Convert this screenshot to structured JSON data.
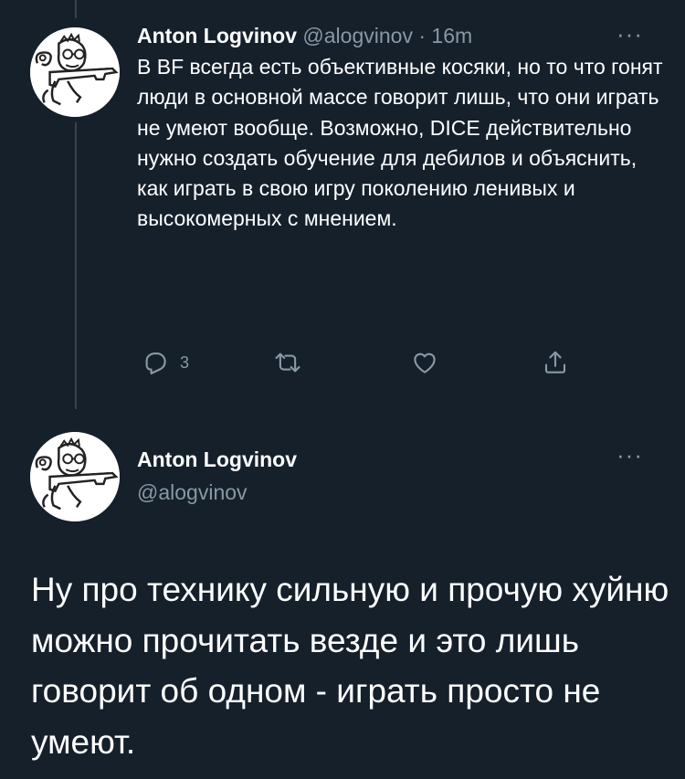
{
  "tweet1": {
    "author_name": "Anton Logvinov",
    "handle": "@alogvinov",
    "separator": "·",
    "time": "16m",
    "more": "···",
    "text": "В BF всегда есть объективные косяки, но то что гонят люди в основной массе говорит лишь, что они играть не умеют вообще. Возможно, DICE действительно нужно создать обучение для дебилов и объяснить, как играть в свою игру поколению ленивых и высокомерных с мнением.",
    "reply_count": "3",
    "icons": [
      "reply-icon",
      "retweet-icon",
      "like-icon",
      "share-icon"
    ]
  },
  "tweet2": {
    "author_name": "Anton Logvinov",
    "handle": "@alogvinov",
    "more": "···",
    "text": "Ну про технику сильную и прочую хуйню можно прочитать везде и это лишь говорит об одном - играть просто не умеют."
  },
  "colors": {
    "background": "#15202b",
    "primary_text": "#ffffff",
    "secondary_text": "#8899a6",
    "thread_line": "#38444d"
  }
}
